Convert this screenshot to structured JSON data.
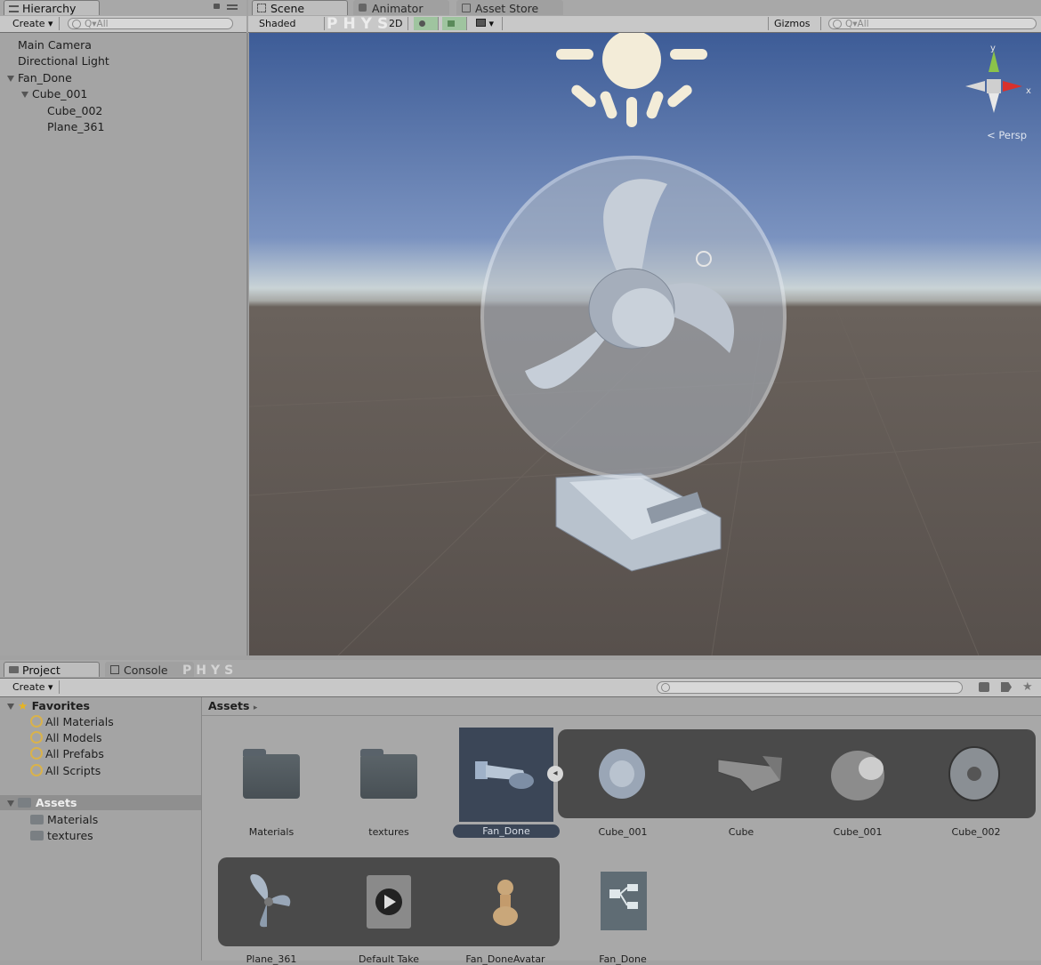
{
  "hierarchy": {
    "tab": "Hierarchy",
    "create": "Create",
    "search_placeholder": "Q▾All",
    "items": [
      "Main Camera",
      "Directional Light",
      "Fan_Done",
      "Cube_001",
      "Cube_002",
      "Plane_361"
    ]
  },
  "scene_tabs": [
    "Scene",
    "Animator",
    "Asset Store"
  ],
  "scene_toolbar": {
    "shaded": "Shaded",
    "mode_2d": "2D",
    "gizmos": "Gizmos",
    "search_placeholder": "Q▾All",
    "watermark": "PHYS"
  },
  "scene": {
    "persp_label": "< Persp",
    "axis_y": "y",
    "axis_x": "x"
  },
  "project": {
    "tabs": [
      "Project",
      "Console"
    ],
    "create": "Create",
    "watermark": "PHYS",
    "favorites_label": "Favorites",
    "favorites": [
      "All Materials",
      "All Models",
      "All Prefabs",
      "All Scripts"
    ],
    "assets_label": "Assets",
    "assets_folders": [
      "Materials",
      "textures"
    ],
    "breadcrumb": "Assets",
    "row1": [
      "Materials",
      "textures",
      "Fan_Done",
      "Cube_001",
      "Cube",
      "Cube_001",
      "Cube_002"
    ],
    "row2": [
      "Plane_361",
      "Default Take",
      "Fan_DoneAvatar",
      "Fan_Done"
    ]
  },
  "colors": {
    "panel_bg": "#a2a2a2",
    "toolbar_bg": "#c8c8c8",
    "sky_top": "#3d5c97",
    "ground": "#57504c",
    "selected_tile": "#3b4657",
    "favorites_star": "#e6b422"
  }
}
